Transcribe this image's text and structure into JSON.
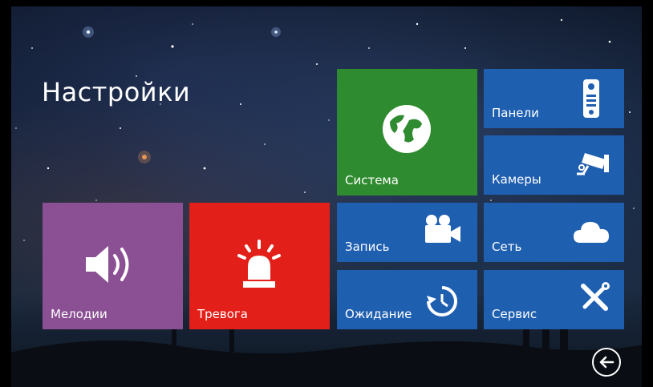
{
  "title": "Настройки",
  "tiles": {
    "melodies": {
      "label": "Мелодии",
      "icon": "speaker-icon",
      "color": "#8b4f94"
    },
    "alarm": {
      "label": "Тревога",
      "icon": "siren-icon",
      "color": "#e31f19"
    },
    "system": {
      "label": "Система",
      "icon": "globe-icon",
      "color": "#2f8b2f"
    },
    "panels": {
      "label": "Панели",
      "icon": "intercom-panel-icon",
      "color": "#1f5fb0"
    },
    "cameras": {
      "label": "Камеры",
      "icon": "cctv-camera-icon",
      "color": "#1f5fb0"
    },
    "record": {
      "label": "Запись",
      "icon": "video-camera-icon",
      "color": "#1f5fb0"
    },
    "network": {
      "label": "Сеть",
      "icon": "cloud-icon",
      "color": "#1f5fb0"
    },
    "standby": {
      "label": "Ожидание",
      "icon": "timer-icon",
      "color": "#1f5fb0"
    },
    "service": {
      "label": "Сервис",
      "icon": "tools-icon",
      "color": "#1f5fb0"
    }
  },
  "back_button": {
    "icon": "back-arrow-icon"
  }
}
